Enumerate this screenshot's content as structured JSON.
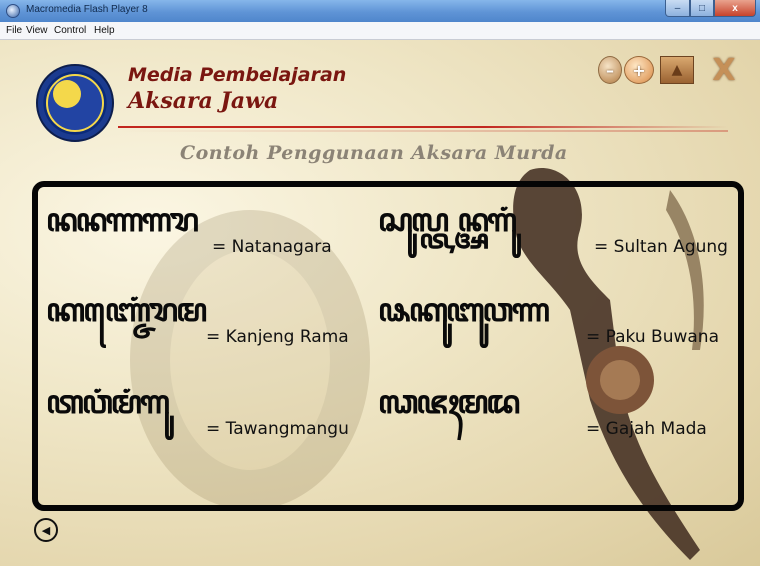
{
  "window": {
    "title": "Macromedia Flash Player 8",
    "controls": {
      "minimize": "–",
      "maximize": "□",
      "close": "x"
    }
  },
  "menu": {
    "items": [
      "File",
      "View",
      "Control",
      "Help"
    ]
  },
  "header": {
    "title_line1": "Media Pembelajaran",
    "title_line2": "Aksara Jawa",
    "tools": {
      "minus": "–",
      "plus": "+",
      "home": "▲",
      "close": "X"
    }
  },
  "section": {
    "title": "Contoh Penggunaan Aksara Murda"
  },
  "examples": [
    {
      "javanese": "ꦤꦤꦟꦒꦫ",
      "latin": "= Natanagara"
    },
    {
      "javanese": "ꦱꦸꦭ꧀ꦠꦤ꧀ꦄꦒꦸꦁ",
      "latin": "= Sultan Agung"
    },
    {
      "javanese": "ꦏꦚ꧀ꦗꦺꦁꦫꦩ",
      "latin": "= Kanjeng Rama"
    },
    {
      "javanese": "ꦦꦏꦸꦧꦸꦮꦟ",
      "latin": "= Paku Buwana"
    },
    {
      "javanese": "ꦠꦮꦁꦩꦁꦒꦸ",
      "latin": "= Tawangmangu"
    },
    {
      "javanese": "ꦓꦗꦃꦩꦢ",
      "latin": "= Gajah Mada"
    }
  ],
  "nav": {
    "back_icon": "◀"
  },
  "colors": {
    "brand_red": "#7a1610",
    "accent_line": "#c2271f",
    "panel_border": "#050505"
  }
}
